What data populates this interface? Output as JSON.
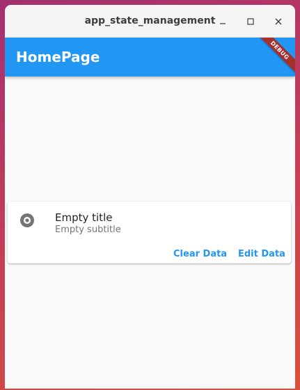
{
  "window": {
    "title": "app_state_management"
  },
  "appbar": {
    "title": "HomePage",
    "debug_banner": "DEBUG"
  },
  "card": {
    "icon": "radio-button-icon",
    "title": "Empty title",
    "subtitle": "Empty subtitle",
    "actions": {
      "clear_label": "Clear Data",
      "edit_label": "Edit Data"
    }
  },
  "colors": {
    "primary": "#2196f3",
    "debug": "#a5302d",
    "background": "#fafafa"
  }
}
